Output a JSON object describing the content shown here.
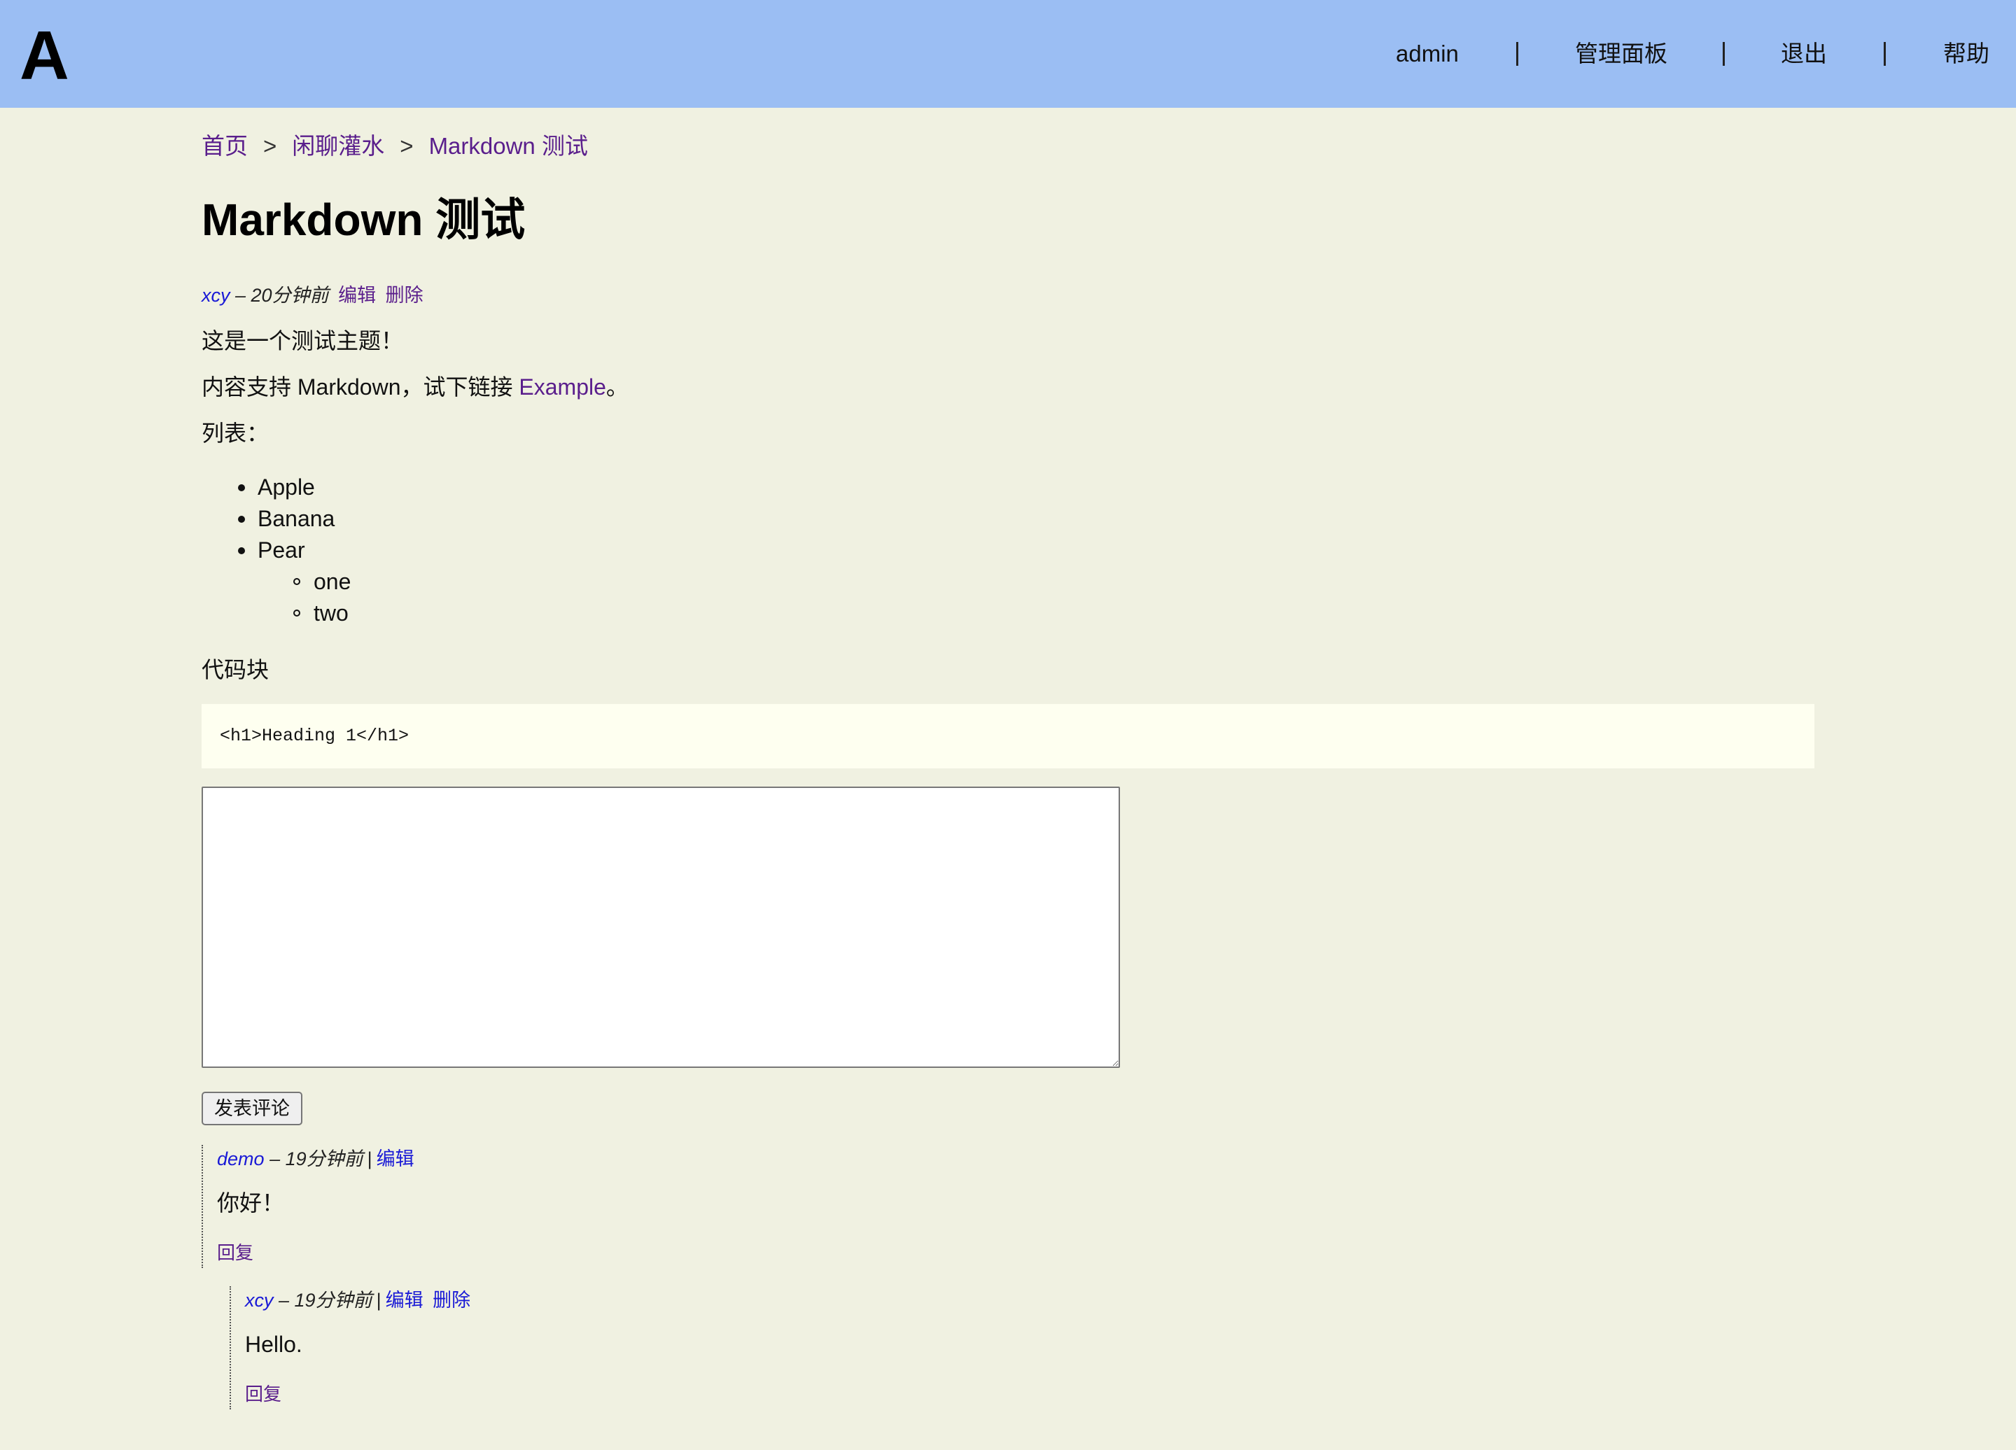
{
  "header": {
    "logo": "A",
    "nav": {
      "user": "admin",
      "admin_panel": "管理面板",
      "logout": "退出",
      "help": "帮助"
    }
  },
  "breadcrumb": {
    "home": "首页",
    "category": "闲聊灌水",
    "current": "Markdown 测试",
    "separator": ">"
  },
  "topic": {
    "title": "Markdown 测试",
    "author": "xcy",
    "time": "– 20分钟前",
    "edit": "编辑",
    "delete": "删除",
    "paragraph1": "这是一个测试主题！",
    "paragraph2_before": "内容支持 Markdown，试下链接 ",
    "paragraph2_link": "Example",
    "paragraph2_after": "。",
    "list_label": "列表：",
    "list_items": [
      "Apple",
      "Banana",
      "Pear"
    ],
    "sub_list_items": [
      "one",
      "two"
    ],
    "code_label": "代码块",
    "code": "<h1>Heading 1</h1>"
  },
  "comment_form": {
    "textarea_value": "",
    "submit_label": "发表评论"
  },
  "comments": [
    {
      "author": "demo",
      "time": "– 19分钟前",
      "separator": "|",
      "edit": "编辑",
      "body": "你好！",
      "reply": "回复"
    },
    {
      "author": "xcy",
      "time": "– 19分钟前",
      "separator": "|",
      "edit": "编辑",
      "delete": "删除",
      "body": "Hello.",
      "reply": "回复"
    }
  ],
  "colors": {
    "header_bg": "#9bbef3",
    "page_bg": "#f0f1e1",
    "link_visited": "#5a1e8c",
    "link": "#1a1ad6",
    "code_bg": "#fefff0"
  }
}
